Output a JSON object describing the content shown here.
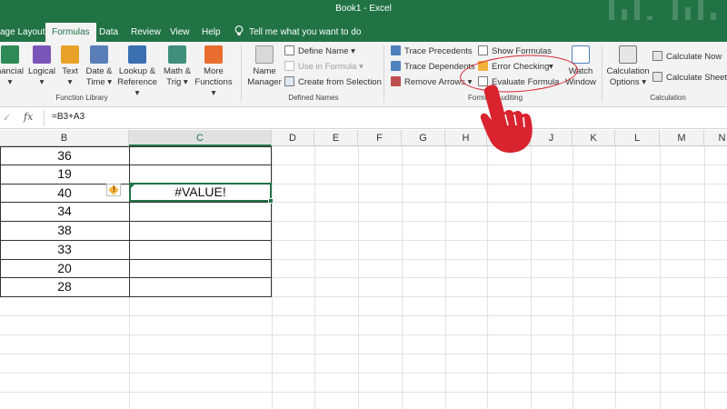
{
  "window": {
    "title": "Book1  -  Excel"
  },
  "tabs": [
    {
      "label": "age Layout"
    },
    {
      "label": "Formulas"
    },
    {
      "label": "Data"
    },
    {
      "label": "Review"
    },
    {
      "label": "View"
    },
    {
      "label": "Help"
    }
  ],
  "tell_me": {
    "placeholder": "Tell me what you want to do"
  },
  "ribbon": {
    "function_library": {
      "label": "Function Library",
      "buttons": [
        {
          "line1": "nancial",
          "line2": "▾",
          "icon": "financial-icon",
          "color": "#2e8b57"
        },
        {
          "line1": "Logical",
          "line2": "▾",
          "icon": "logical-icon",
          "color": "#7a55b8"
        },
        {
          "line1": "Text",
          "line2": "▾",
          "icon": "text-icon",
          "color": "#e8a229"
        },
        {
          "line1": "Date &",
          "line2": "Time ▾",
          "icon": "date-time-icon",
          "color": "#5a7fb8"
        },
        {
          "line1": "Lookup &",
          "line2": "Reference ▾",
          "icon": "lookup-icon",
          "color": "#3a6fb0"
        },
        {
          "line1": "Math &",
          "line2": "Trig ▾",
          "icon": "math-icon",
          "color": "#3f8f7b"
        },
        {
          "line1": "More",
          "line2": "Functions ▾",
          "icon": "more-functions-icon",
          "color": "#e86d2e"
        }
      ]
    },
    "defined_names": {
      "label": "Defined Names",
      "name_manager_line1": "Name",
      "name_manager_line2": "Manager",
      "define_name": "Define Name  ▾",
      "use_in_formula": "Use in Formula  ▾",
      "create_from_selection": "Create from Selection"
    },
    "formula_auditing": {
      "label": "Formula Auditing",
      "trace_precedents": "Trace Precedents",
      "trace_dependents": "Trace Dependents",
      "remove_arrows": "Remove Arrows  ▾",
      "show_formulas": "Show Formulas",
      "error_checking": "Error Checking",
      "error_checking_arrow": "▾",
      "evaluate_formula": "Evaluate Formula",
      "watch_window_line1": "Watch",
      "watch_window_line2": "Window"
    },
    "calculation": {
      "label": "Calculation",
      "options_line1": "Calculation",
      "options_line2": "Options ▾",
      "calculate_now": "Calculate Now",
      "calculate_sheet": "Calculate Sheet"
    }
  },
  "formula_bar": {
    "cancel": "✓",
    "fx": "fx",
    "formula": "=B3+A3"
  },
  "columns": [
    "B",
    "C",
    "D",
    "E",
    "F",
    "G",
    "H",
    "I",
    "J",
    "K",
    "L",
    "M",
    "N"
  ],
  "column_b_values": [
    "36",
    "19",
    "40",
    "34",
    "38",
    "33",
    "20",
    "28"
  ],
  "active_cell_value": "#VALUE!",
  "colors": {
    "accent": "#217346",
    "annotation": "#d9232e"
  }
}
